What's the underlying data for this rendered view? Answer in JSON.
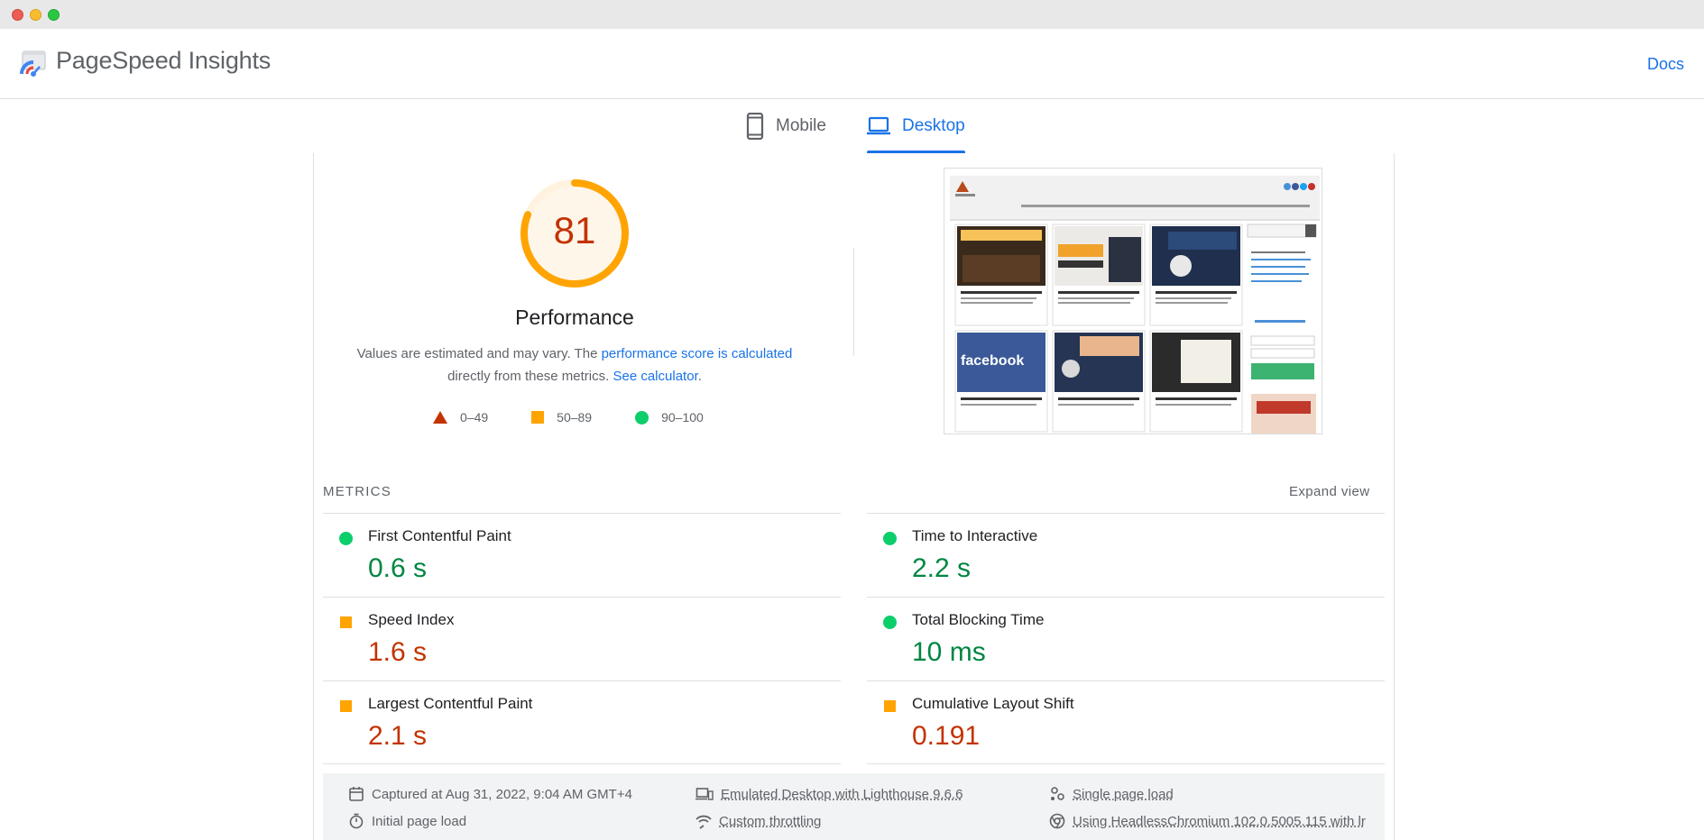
{
  "app": {
    "title": "PageSpeed Insights",
    "docs_label": "Docs"
  },
  "tabs": [
    {
      "label": "Mobile",
      "icon": "smartphone-icon",
      "active": false
    },
    {
      "label": "Desktop",
      "icon": "laptop-icon",
      "active": true
    }
  ],
  "performance": {
    "score": "81",
    "score_value": 81,
    "label": "Performance",
    "note_prefix": "Values are estimated and may vary. The ",
    "note_link1": "performance score is calculated",
    "note_middle": " directly from these metrics. ",
    "note_link2": "See calculator",
    "note_suffix": ".",
    "status_color": "#ffa400"
  },
  "legend": [
    {
      "range": "0–49",
      "shape": "triangle",
      "color": "#c33300"
    },
    {
      "range": "50–89",
      "shape": "square",
      "color": "#ffa400"
    },
    {
      "range": "90–100",
      "shape": "circle",
      "color": "#0cce6b"
    }
  ],
  "metrics": {
    "title": "METRICS",
    "expand_label": "Expand view",
    "left": [
      {
        "name": "First Contentful Paint",
        "value": "0.6 s",
        "rating": "good"
      },
      {
        "name": "Speed Index",
        "value": "1.6 s",
        "rating": "average"
      },
      {
        "name": "Largest Contentful Paint",
        "value": "2.1 s",
        "rating": "average"
      }
    ],
    "right": [
      {
        "name": "Time to Interactive",
        "value": "2.2 s",
        "rating": "good"
      },
      {
        "name": "Total Blocking Time",
        "value": "10 ms",
        "rating": "good"
      },
      {
        "name": "Cumulative Layout Shift",
        "value": "0.191",
        "rating": "average"
      }
    ]
  },
  "info": {
    "captured": "Captured at Aug 31, 2022, 9:04 AM GMT+4",
    "initial_load": "Initial page load",
    "emulated": "Emulated Desktop with Lighthouse 9.6.6",
    "throttling": "Custom throttling",
    "single_load": "Single page load",
    "browser": "Using HeadlessChromium 102.0.5005.115 with lr"
  },
  "screenshot_preview": {
    "description_icon": "page-thumbnail",
    "cards_top": [
      "أفضل كتب التسويق للمبتدئين",
      "إستراتيجية للتسويق",
      "أفضل مواقع الأفلييت منها عربية"
    ],
    "cards_bottom": [
      "facebook",
      "البرنامج التدريبي المتكامل لياسر سليم",
      "كيفية الربح من المدونات"
    ]
  },
  "colors": {
    "accent": "#1a73e8",
    "good": "#0cce6b",
    "average": "#ffa400",
    "poor": "#c33300"
  }
}
